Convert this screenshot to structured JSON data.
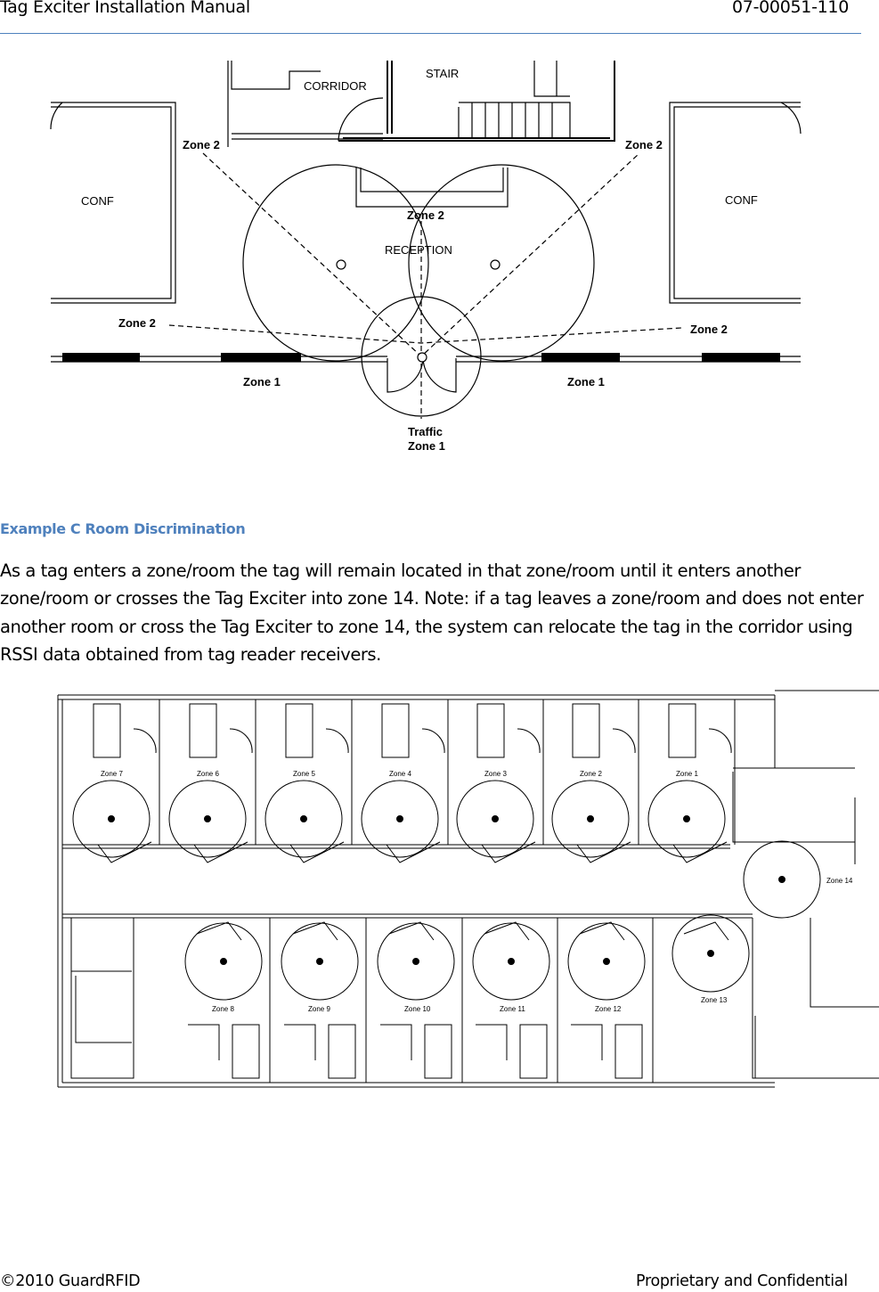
{
  "header": {
    "title": "Tag Exciter Installation Manual",
    "doc_number": "07-00051-110"
  },
  "diagram1": {
    "corridor": "CORRIDOR",
    "stair": "STAIR",
    "conf_left": "CONF",
    "conf_right": "CONF",
    "reception": "RECEPTION",
    "zone2_top_left": "Zone 2",
    "zone2_top_right": "Zone 2",
    "zone2_center": "Zone 2",
    "zone2_mid_left": "Zone 2",
    "zone2_mid_right": "Zone 2",
    "zone1_left": "Zone 1",
    "zone1_right": "Zone 1",
    "traffic": "Traffic",
    "traffic_zone": "Zone 1"
  },
  "section": {
    "heading": "Example C Room Discrimination",
    "body": "As a tag enters a zone/room the tag will remain located in that zone/room until it enters another zone/room or crosses the Tag Exciter into zone 14. Note: if a tag leaves a zone/room and does not enter another room or cross the Tag Exciter to zone 14, the system can relocate the tag in the corridor using RSSI data obtained from tag reader receivers."
  },
  "diagram2": {
    "top_zones": [
      "Zone 7",
      "Zone 6",
      "Zone 5",
      "Zone 4",
      "Zone 3",
      "Zone 2",
      "Zone 1"
    ],
    "bottom_zones": [
      "Zone 8",
      "Zone 9",
      "Zone 10",
      "Zone 11",
      "Zone 12"
    ],
    "zone13": "Zone 13",
    "zone14": "Zone 14"
  },
  "footer": {
    "copyright": "©2010 GuardRFID",
    "notice": "Proprietary and Confidential"
  },
  "colors": {
    "accent": "#4f81bd"
  }
}
